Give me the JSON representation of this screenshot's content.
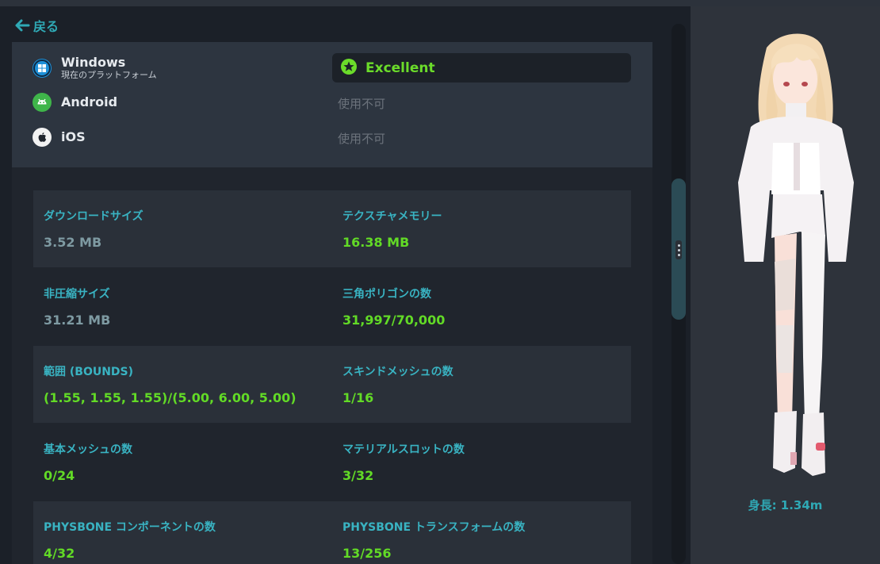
{
  "nav": {
    "back_label": "戻る"
  },
  "platforms": [
    {
      "name": "Windows",
      "sub": "現在のプラットフォーム",
      "status": "Excellent",
      "icon": "windows-icon"
    },
    {
      "name": "Android",
      "status": "使用不可",
      "icon": "android-icon"
    },
    {
      "name": "iOS",
      "status": "使用不可",
      "icon": "apple-icon"
    }
  ],
  "stats": [
    {
      "label": "ダウンロードサイズ",
      "value": "3.52 MB"
    },
    {
      "label": "テクスチャメモリー",
      "value": "16.38 MB"
    },
    {
      "label": "非圧縮サイズ",
      "value": "31.21 MB"
    },
    {
      "label": "三角ポリゴンの数",
      "value": "31,997/70,000"
    },
    {
      "label": "範囲 (BOUNDS)",
      "value": "(1.55, 1.55, 1.55)/(5.00, 6.00, 5.00)"
    },
    {
      "label": "スキンドメッシュの数",
      "value": "1/16"
    },
    {
      "label": "基本メッシュの数",
      "value": "0/24"
    },
    {
      "label": "マテリアルスロットの数",
      "value": "3/32"
    },
    {
      "label": "PHYSBONE コンポーネントの数",
      "value": "4/32"
    },
    {
      "label": "PHYSBONE トランスフォームの数",
      "value": "13/256"
    }
  ],
  "avatar": {
    "height_label": "身長: 1.34m"
  },
  "colors": {
    "accent": "#2fa9b5",
    "label": "#39b3c2",
    "good": "#62da26",
    "muted": "#7e9aa2",
    "windows": "#1e90d8",
    "android": "#3fb54a"
  }
}
